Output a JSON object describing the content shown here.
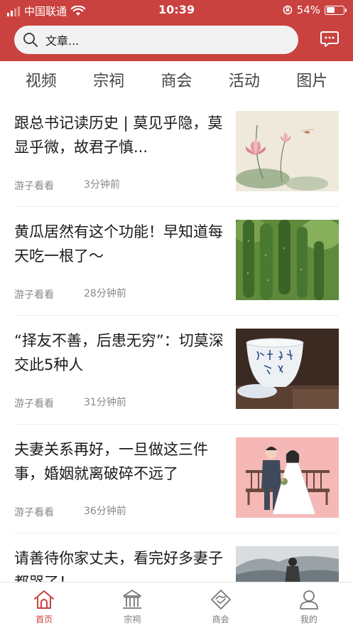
{
  "status_bar": {
    "carrier": "中国联通",
    "time": "10:39",
    "battery": "54%",
    "battery_level": 0.54
  },
  "search": {
    "placeholder": "文章..."
  },
  "tabs": [
    {
      "label": "视频"
    },
    {
      "label": "宗祠"
    },
    {
      "label": "商会"
    },
    {
      "label": "活动"
    },
    {
      "label": "图片"
    }
  ],
  "articles": [
    {
      "title": "跟总书记读历史 | 莫见乎隐，莫显乎微，故君子慎...",
      "source": "游子看看",
      "time": "3分钟前",
      "thumb": "lotus-painting"
    },
    {
      "title": "黄瓜居然有这个功能！早知道每天吃一根了～",
      "source": "游子看看",
      "time": "28分钟前",
      "thumb": "cucumbers"
    },
    {
      "title": "“择友不善，后患无穷”：切莫深交此5种人",
      "source": "游子看看",
      "time": "31分钟前",
      "thumb": "tea-cup"
    },
    {
      "title": "夫妻关系再好，一旦做这三件事，婚姻就离破碎不远了",
      "source": "游子看看",
      "time": "36分钟前",
      "thumb": "wedding-couple"
    },
    {
      "title": "请善待你家丈夫，看完好多妻子都哭了！",
      "source": "",
      "time": "",
      "thumb": "landscape-woman"
    }
  ],
  "bottom_nav": [
    {
      "label": "首页",
      "icon": "home-icon",
      "active": true
    },
    {
      "label": "宗祠",
      "icon": "temple-icon",
      "active": false
    },
    {
      "label": "商会",
      "icon": "handshake-icon",
      "active": false
    },
    {
      "label": "我的",
      "icon": "user-icon",
      "active": false
    }
  ],
  "colors": {
    "brand_red": "#c9423f",
    "active_nav": "#c9423f"
  }
}
